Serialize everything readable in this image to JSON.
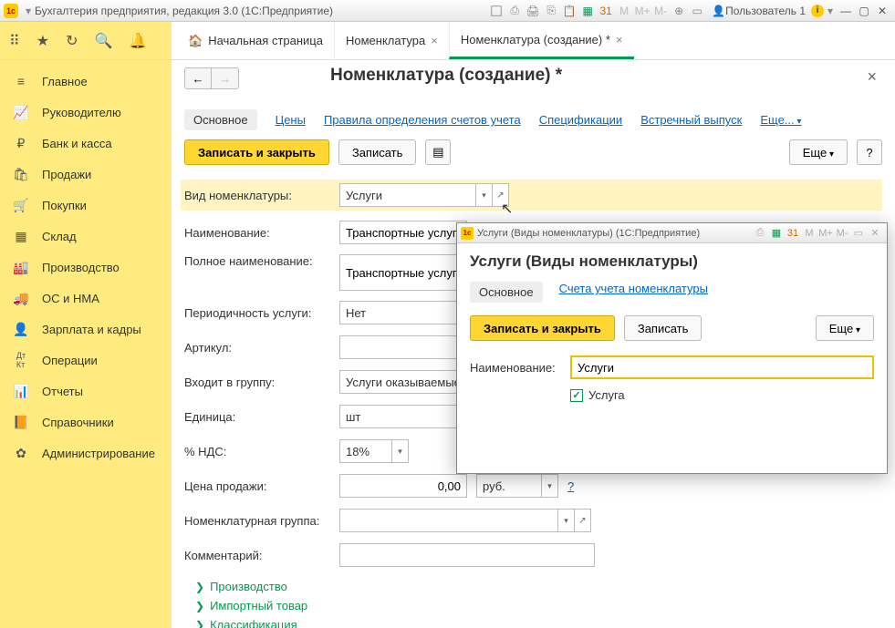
{
  "titlebar": {
    "title": "Бухгалтерия предприятия, редакция 3.0  (1С:Предприятие)",
    "user": "Пользователь 1",
    "m_labels": [
      "M",
      "M+",
      "M-"
    ]
  },
  "tabs": {
    "home": "Начальная страница",
    "items": [
      {
        "label": "Номенклатура",
        "active": false
      },
      {
        "label": "Номенклатура (создание) *",
        "active": true
      }
    ]
  },
  "sidebar": {
    "items": [
      {
        "label": "Главное"
      },
      {
        "label": "Руководителю"
      },
      {
        "label": "Банк и касса"
      },
      {
        "label": "Продажи"
      },
      {
        "label": "Покупки"
      },
      {
        "label": "Склад"
      },
      {
        "label": "Производство"
      },
      {
        "label": "ОС и НМА"
      },
      {
        "label": "Зарплата и кадры"
      },
      {
        "label": "Операции"
      },
      {
        "label": "Отчеты"
      },
      {
        "label": "Справочники"
      },
      {
        "label": "Администрирование"
      }
    ]
  },
  "page": {
    "title": "Номенклатура (создание) *",
    "subtabs": {
      "active": "Основное",
      "items": [
        "Цены",
        "Правила определения счетов учета",
        "Спецификации",
        "Встречный выпуск"
      ],
      "more": "Еще..."
    },
    "actions": {
      "save_close": "Записать и закрыть",
      "save": "Записать",
      "more": "Еще",
      "help": "?"
    },
    "form": {
      "vid_label": "Вид номенклатуры:",
      "vid_value": "Услуги",
      "name_label": "Наименование:",
      "name_value": "Транспортные услуги",
      "fullname_label": "Полное наименование:",
      "fullname_value": "Транспортные услуги",
      "period_label": "Периодичность услуги:",
      "period_value": "Нет",
      "artikul_label": "Артикул:",
      "artikul_value": "",
      "group_label": "Входит в группу:",
      "group_value": "Услуги оказываемые",
      "unit_label": "Единица:",
      "unit_value": "шт",
      "nds_label": "% НДС:",
      "nds_value": "18%",
      "price_label": "Цена продажи:",
      "price_value": "0,00",
      "price_currency": "руб.",
      "price_help": "?",
      "nomgroup_label": "Номенклатурная группа:",
      "nomgroup_value": "",
      "comment_label": "Комментарий:",
      "comment_value": "",
      "tree": [
        "Производство",
        "Импортный товар",
        "Классификация"
      ]
    },
    "nav": {
      "back": "←",
      "forward": "→"
    }
  },
  "dialog": {
    "titlebar": "Услуги (Виды номенклатуры)  (1С:Предприятие)",
    "title": "Услуги (Виды номенклатуры)",
    "subtabs": {
      "active": "Основное",
      "other": "Счета учета номенклатуры"
    },
    "actions": {
      "save_close": "Записать и закрыть",
      "save": "Записать",
      "more": "Еще"
    },
    "form": {
      "name_label": "Наименование:",
      "name_value": "Услуги",
      "service_label": "Услуга",
      "service_checked": true
    },
    "m_labels": [
      "M",
      "M+",
      "M-"
    ]
  }
}
